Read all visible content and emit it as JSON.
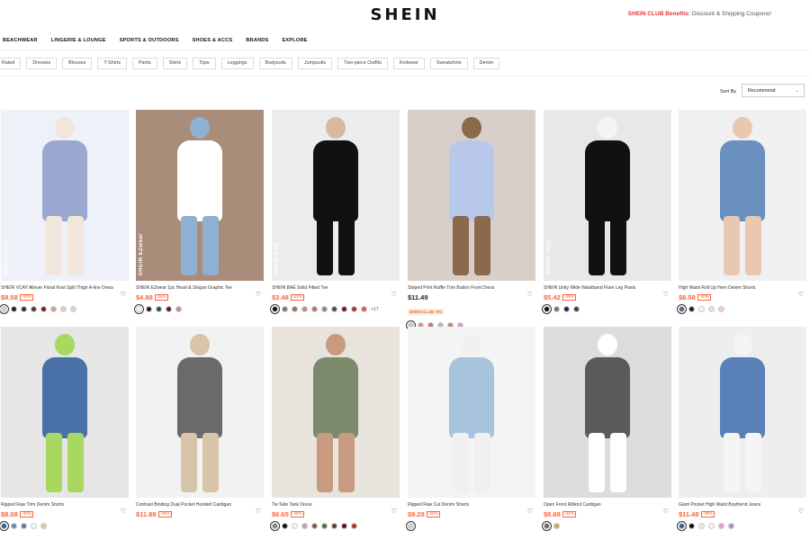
{
  "header": {
    "logo": "SHEIN",
    "promo_club": "SHEIN CLUB Benefits:",
    "promo_text": " Discount & Shipping Coupons!"
  },
  "nav": [
    "BEACHWEAR",
    "LINGERIE & LOUNGE",
    "SPORTS & OUTDOORS",
    "SHOES & ACCS",
    "BRANDS",
    "EXPLORE"
  ],
  "filters": [
    "Rated",
    "Dresses",
    "Blouses",
    "T-Shirts",
    "Pants",
    "Skirts",
    "Tops",
    "Leggings",
    "Bodysuits",
    "Jumpsuits",
    "Two-piece Outfits",
    "Knitwear",
    "Sweatshirts",
    "Denim"
  ],
  "sort": {
    "label": "Sort By",
    "value": "Recommend"
  },
  "products": [
    {
      "title": "SHEIN VCAY Allover Floral Knot Split Thigh A-line Dress",
      "price": "$9.58",
      "discount": "-42%",
      "brandmark": "SHEIN VCAY",
      "colors": [
        "#c9cce6",
        "#222222",
        "#333333",
        "#5a3a2a",
        "#7a1f1f",
        "#d8a07a",
        "#e8c8d8",
        "#c8d8e8"
      ],
      "img": [
        "#eef1f8",
        "#9aa8d0",
        "#f1e6dc"
      ]
    },
    {
      "title": "SHEIN EZwear 1pc Heart & Slogan Graphic Tee",
      "price": "$4.88",
      "discount": "-44%",
      "brandmark": "SHEIN EZwear",
      "colors": [
        "#f4f4f4",
        "#222222",
        "#1e5a5a",
        "#6a1a1a",
        "#cc8888"
      ],
      "img": [
        "#a98c7a",
        "#ffffff",
        "#8fb0d0"
      ]
    },
    {
      "title": "SHEIN BAE Solid Fitted Tee",
      "price": "$3.48",
      "discount": "-51%",
      "brandmark": "SHEIN BAE",
      "colors": [
        "#111111",
        "#777777",
        "#a07050",
        "#cc8877",
        "#aa7777",
        "#7a8a9a",
        "#5a4a3a",
        "#7a1a2a",
        "#aa3333",
        "#cc6666"
      ],
      "more": "+17",
      "img": [
        "#ececec",
        "#111111",
        "#d8b8a0"
      ]
    },
    {
      "title": "Striped Print Ruffle Trim Button Front Dress",
      "price": "$11.49",
      "discount": "",
      "club": "SHEIN CLUB -5%",
      "brandmark": "",
      "colors": [
        "#b8c4e0",
        "#c8a070",
        "#cc7080",
        "#a8b8c8",
        "#c08a70",
        "#d0a0b0"
      ],
      "img": [
        "#d8d0c8",
        "#b8c8ea",
        "#8a6a4a"
      ]
    },
    {
      "title": "SHEIN Unity Wide Waistband Flare Leg Pants",
      "price": "$5.42",
      "discount": "-49%",
      "brandmark": "SHEIN Unity",
      "colors": [
        "#111111",
        "#777777",
        "#1a2a5a",
        "#5a3a2a"
      ],
      "img": [
        "#e8e8e8",
        "#111111",
        "#f4f4f4"
      ]
    },
    {
      "title": "High Waist Roll Up Hem Denim Shorts",
      "price": "$8.58",
      "discount": "-40%",
      "brandmark": "",
      "colors": [
        "#4a6a9a",
        "#222222",
        "#f4f4f4",
        "#d8e4f0",
        "#f0c8e0"
      ],
      "img": [
        "#f0f0f0",
        "#6a90c0",
        "#e8c8b0"
      ]
    },
    {
      "title": "Ripped Raw Trim Denim Shorts",
      "price": "$8.08",
      "discount": "-40%",
      "brandmark": "",
      "colors": [
        "#3a5a8a",
        "#6a8ab0",
        "#6a7aa0",
        "#f4f4f4",
        "#d8c8a0"
      ],
      "img": [
        "#e6e6e6",
        "#4a70a8",
        "#a8d860"
      ]
    },
    {
      "title": "Contrast Binding Dual Pocket Hooded Cardigan",
      "price": "$11.88",
      "discount": "-45%",
      "brandmark": "",
      "colors": [],
      "img": [
        "#f2f2f2",
        "#6a6a6a",
        "#d8c4a8"
      ]
    },
    {
      "title": "Tie Side Tank Dress",
      "price": "$6.65",
      "discount": "-49%",
      "brandmark": "",
      "colors": [
        "#7a8a6a",
        "#111111",
        "#f4f4f4",
        "#c8a0b0",
        "#8a5a4a",
        "#5a6a4a",
        "#6a3a2a",
        "#5a1a1a",
        "#aa3a2a"
      ],
      "img": [
        "#e8e4dc",
        "#7a8a6a",
        "#c89a80"
      ]
    },
    {
      "title": "Ripped Raw Cut Denim Shorts",
      "price": "$9.28",
      "discount": "-20%",
      "brandmark": "",
      "colors": [
        "#c8d0d8"
      ],
      "img": [
        "#f4f4f4",
        "#a8c4dc",
        "#f0f0f0"
      ]
    },
    {
      "title": "Open Front Ribknit Cardigan",
      "price": "$8.68",
      "discount": "-42%",
      "brandmark": "",
      "colors": [
        "#666666",
        "#d8a070"
      ],
      "img": [
        "#dcdcdc",
        "#5a5a5a",
        "#ffffff"
      ]
    },
    {
      "title": "Giant Pocket High Waist Boyfriend Jeans",
      "price": "$11.48",
      "discount": "-30%",
      "brandmark": "",
      "colors": [
        "#3a5a9a",
        "#111111",
        "#e8e8e8",
        "#f4f4f4",
        "#e8a0c8",
        "#b090d0"
      ],
      "img": [
        "#eeeeee",
        "#5a80b8",
        "#f4f4f4"
      ]
    }
  ]
}
